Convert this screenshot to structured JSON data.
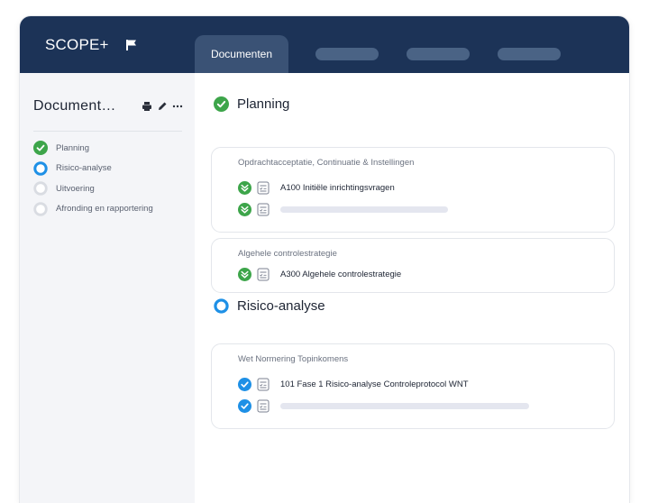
{
  "app": {
    "brand": "SCOPE+",
    "active_tab": "Documenten",
    "colors": {
      "header": "#1c3357",
      "accent_blue": "#1e90e6",
      "success_green": "#3da54a"
    }
  },
  "sidebar": {
    "title": "Document…",
    "tools": [
      "print-icon",
      "pencil-icon",
      "more-icon"
    ],
    "steps": [
      {
        "label": "Planning",
        "status": "done"
      },
      {
        "label": "Risico-analyse",
        "status": "current"
      },
      {
        "label": "Uitvoering",
        "status": "todo"
      },
      {
        "label": "Afronding en rapportering",
        "status": "todo"
      }
    ]
  },
  "main": {
    "sections": [
      {
        "title": "Planning",
        "status": "done",
        "cards": [
          {
            "header": "Opdrachtacceptatie, Continuatie & Instellingen",
            "rows": [
              {
                "label": "A100 Initiële inrichtingsvragen"
              },
              {
                "label": ""
              }
            ]
          },
          {
            "header": "Algehele controlestrategie",
            "rows": [
              {
                "label": "A300 Algehele controlestrategie"
              }
            ]
          }
        ]
      },
      {
        "title": "Risico-analyse",
        "status": "current",
        "cards": [
          {
            "header": "Wet Normering Topinkomens",
            "rows": [
              {
                "label": "101 Fase 1 Risico-analyse Controleprotocol WNT"
              },
              {
                "label": ""
              }
            ]
          }
        ]
      }
    ]
  }
}
